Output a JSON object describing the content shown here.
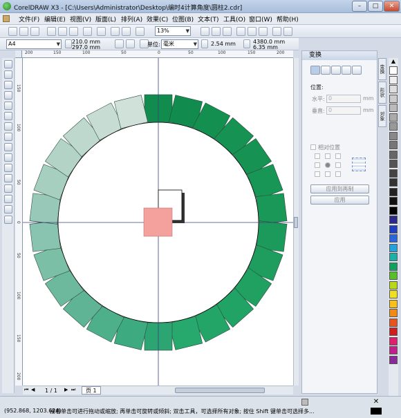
{
  "window": {
    "title": "CorelDRAW X3 - [C:\\Users\\Administrator\\Desktop\\编时4计算角度\\圆柱2.cdr]",
    "minimize": "–",
    "maximize": "□",
    "close": "✕"
  },
  "menu": [
    "文件(F)",
    "编辑(E)",
    "视图(V)",
    "版面(L)",
    "排列(A)",
    "效果(C)",
    "位图(B)",
    "文本(T)",
    "工具(O)",
    "窗口(W)",
    "帮助(H)"
  ],
  "toolbar": {
    "zoom": "13%"
  },
  "property_bar": {
    "paper": "A4",
    "width": "210.0 mm",
    "height": "297.0 mm",
    "units_label": "单位:",
    "units": "毫米",
    "nudge": "2.54 mm",
    "dup_x": "4380.0 mm",
    "dup_y": "6.35 mm"
  },
  "ruler": {
    "h_ticks": [
      "200",
      "150",
      "100",
      "50",
      "0",
      "50",
      "100",
      "150",
      "200"
    ],
    "v_ticks": [
      "150",
      "100",
      "50",
      "0",
      "50",
      "100",
      "150",
      "200"
    ]
  },
  "canvas": {
    "ring_colors": [
      "#118c4e",
      "#118c4e",
      "#13904f",
      "#169352",
      "#169352",
      "#189656",
      "#1a9858",
      "#1c9a5b",
      "#1e9d5e",
      "#20a061",
      "#21a365",
      "#24a568",
      "#27a86c",
      "#2ca572",
      "#3eaa80",
      "#4eaf8b",
      "#5fb496",
      "#6cb99e",
      "#7bbfa7",
      "#89c4b0",
      "#98c9b8",
      "#a6cfc0",
      "#b2d3c6",
      "#bed8cd",
      "#c7dcd3",
      "#cfe1d9"
    ],
    "center_square_color": "#f4a09c",
    "outline_square_color": "#ffffff"
  },
  "page_nav": {
    "counter": "1 / 1",
    "tab": "页 1"
  },
  "docker": {
    "title": "变换",
    "position_label": "位置:",
    "h_label": "水平:",
    "v_label": "垂直:",
    "h_value": "0",
    "v_value": "0",
    "unit": "mm",
    "relative_label": "相对位置",
    "apply_copy": "应用到再制",
    "apply": "应用"
  },
  "docker_tabs": [
    "变换",
    "形状",
    "对象"
  ],
  "palette": [
    "#ffffff",
    "#eeeeee",
    "#dddddd",
    "#cccccc",
    "#bbbbbb",
    "#aaaaaa",
    "#999999",
    "#888888",
    "#777777",
    "#666666",
    "#555555",
    "#444444",
    "#333333",
    "#222222",
    "#111111",
    "#000000",
    "#2a2a8a",
    "#1e3fbf",
    "#2a66d8",
    "#25a0d8",
    "#1ab0a8",
    "#10a060",
    "#5abd2a",
    "#b8d81e",
    "#f0e020",
    "#f8c018",
    "#f08a18",
    "#e8541c",
    "#d01e1e",
    "#e01e6e",
    "#c0208a",
    "#8a2a9a"
  ],
  "status": {
    "coords": "(952.868, 1203.624)",
    "message": "接着单击可进行拖动或缩放; 再单击可旋转或倾斜; 双击工具，可选择所有对象; 按住 Shift 键单击可选择多..."
  }
}
